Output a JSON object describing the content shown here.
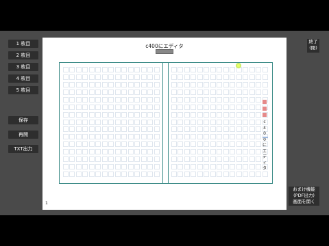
{
  "sheets": [
    {
      "label": "1 枚目"
    },
    {
      "label": "2 枚目"
    },
    {
      "label": "3 枚目"
    },
    {
      "label": "4 枚目"
    },
    {
      "label": "5 枚目"
    }
  ],
  "tools": {
    "save_label": "保存",
    "restore_label": "再開",
    "txt_export_label": "TXT出力"
  },
  "exit_button": {
    "line1": "終了",
    "line2": "(閉)"
  },
  "bonus_button": {
    "line1": "おまけ機能",
    "line2": "(PDF出力)",
    "line3": "画面を開く"
  },
  "document": {
    "title": "c400にエディタ",
    "page_number": "1",
    "vertical_text": [
      "c",
      "4",
      "0",
      "0",
      "に",
      "エ",
      "デ",
      "ィ",
      "タ"
    ]
  },
  "colors": {
    "grid_border": "#3a8a86",
    "cell_border": "#dfe6ee",
    "marker_red": "#e58a8a",
    "cursor": "#b4e05a"
  }
}
